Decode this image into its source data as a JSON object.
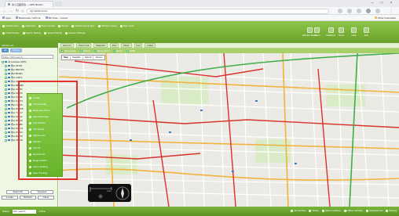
{
  "browser": {
    "tab_title": "北斗卫星定位 — GPS Monitor",
    "url": "(Q) ip/bd/monitor",
    "bookmarks": [
      "Apps",
      "Bookmarks / GPS 11",
      "BD Tools · monitor"
    ],
    "right_bookmark": "Other bookmarks"
  },
  "toolbar": {
    "left_row1": [
      "Vehicle Mon.",
      "Historical",
      "Alarm Center",
      "Report",
      "Vehicle Group Mgr.",
      "Platform Query",
      "Map Tools"
    ],
    "left_row2": [
      "Track Replay",
      "Region Setting",
      "Speed Setting",
      "System Settings"
    ],
    "right_items": [
      "Monitor Mode",
      "Alarm",
      "Statistics",
      "Tools",
      "Help",
      "Exit"
    ]
  },
  "left_panel": {
    "title": "Vehicle List",
    "tabs": [
      "All",
      "Online"
    ],
    "search_placeholder": "Plate / SIM search",
    "tree": [
      "All vehicles (23/5)",
      "鲁A·39701",
      "鲁A·B9F700",
      "鲁A·BF461",
      "鲁A·L0871",
      "鲁A·S88976 (2/0)",
      "鲁A·88568F",
      "鲁A·C8251",
      "鲁A·F1205",
      "鲁A·K0396",
      "鲁A·Q7741",
      "鲁A·T2260",
      "鲁A·W5508",
      "鲁A·Y3317",
      "鲁A·Z9042",
      "鲁A·D6615",
      "鲁A·H4480",
      "鲁A·M1123",
      "鲁A·P7064",
      "鲁A·R2276",
      "鲁A·V8830"
    ],
    "bottom_buttons": [
      "Select All",
      "Deselect"
    ],
    "footer_buttons": [
      "Locate",
      "Refresh",
      "Close"
    ]
  },
  "map": {
    "toolbar": [
      "Zoom In",
      "Zoom Out",
      "Measure",
      "Pan",
      "Ruler",
      "Full",
      "Label"
    ],
    "layer_bar": [
      "Show plate",
      "Follow",
      "Show alarm",
      "Road",
      "Traffic"
    ],
    "map_types": [
      "Map",
      "Satellite",
      "Hybrid",
      "Terrain"
    ],
    "scale": [
      "0",
      "1 km"
    ]
  },
  "context_menu": [
    "Locate",
    "Track Replay",
    "Real-time Photo",
    "Send Message",
    "Call Vehicle",
    "Set Speed",
    "Vehicle Info",
    "Monitor",
    "Cut Oil",
    "Restore Oil",
    "Region Alarm",
    "Fence Setting",
    "Stop Tracking"
  ],
  "status": {
    "left_label": "Status",
    "input_value": "Veh. search",
    "mid_label": "Online",
    "right_items": [
      "All vehicles",
      "Online",
      "Alarm vehicles",
      "Offline vehicles",
      "Unpositioned",
      "Moving"
    ]
  },
  "colors": {
    "toolbar_green": "#6aa12a",
    "alarm_red": "#e0332a",
    "menu_green": "#7cc23a"
  }
}
